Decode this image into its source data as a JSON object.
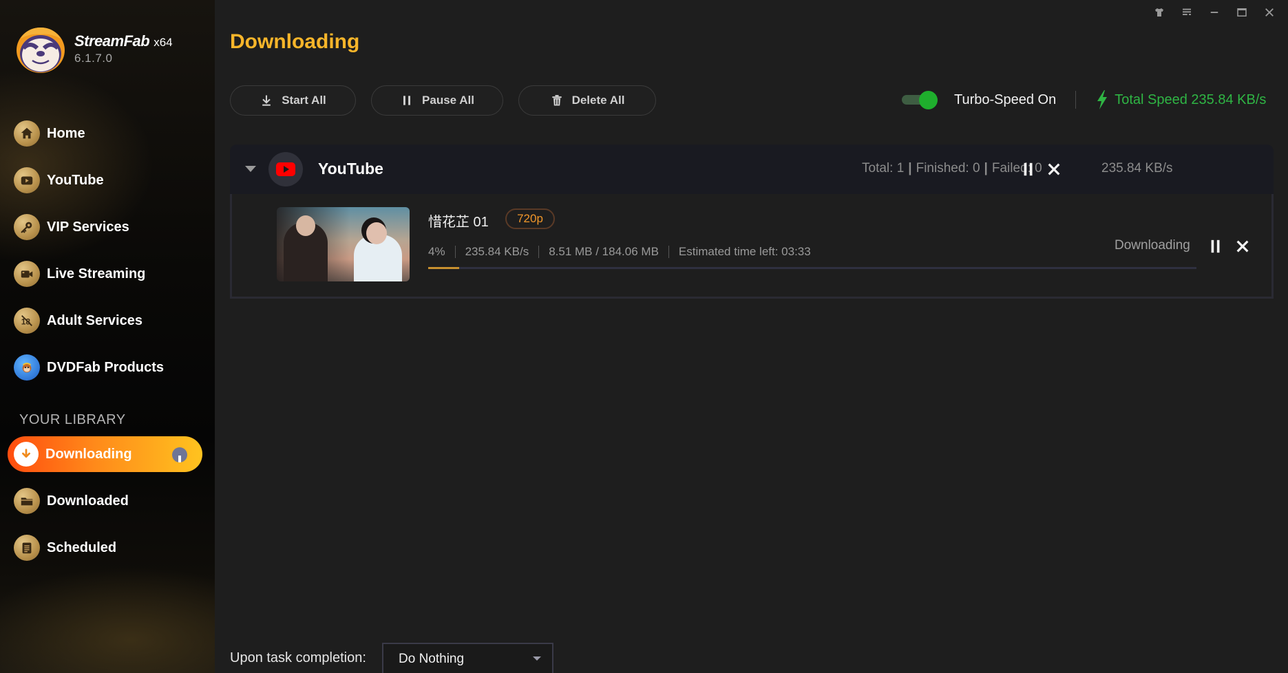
{
  "app": {
    "name": "StreamFab",
    "arch": "x64",
    "version": "6.1.7.0"
  },
  "window_controls": [
    {
      "name": "skin-icon",
      "label": "Skin"
    },
    {
      "name": "menu-icon",
      "label": "Menu"
    },
    {
      "name": "minimize-icon",
      "label": "Minimize"
    },
    {
      "name": "maximize-icon",
      "label": "Maximize"
    },
    {
      "name": "close-icon",
      "label": "Close"
    }
  ],
  "sidebar": {
    "items": [
      {
        "label": "Home",
        "icon": "home-icon"
      },
      {
        "label": "YouTube",
        "icon": "youtube-icon"
      },
      {
        "label": "VIP Services",
        "icon": "key-icon"
      },
      {
        "label": "Live Streaming",
        "icon": "video-camera-icon"
      },
      {
        "label": "Adult Services",
        "icon": "no-18-icon"
      },
      {
        "label": "DVDFab Products",
        "icon": "dvdfab-mascot-icon"
      }
    ],
    "library_title": "YOUR LIBRARY",
    "library": [
      {
        "label": "Downloading",
        "icon": "download-icon",
        "active": true
      },
      {
        "label": "Downloaded",
        "icon": "folder-icon",
        "active": false
      },
      {
        "label": "Scheduled",
        "icon": "clipboard-list-icon",
        "active": false
      }
    ]
  },
  "main": {
    "title": "Downloading",
    "toolbar": {
      "start_all": "Start All",
      "pause_all": "Pause All",
      "delete_all": "Delete All"
    },
    "turbo": {
      "enabled": true,
      "label": "Turbo-Speed On"
    },
    "total_speed": "Total Speed 235.84 KB/s",
    "colors": {
      "accent": "#f7b52a",
      "speed_green": "#2fb544",
      "active_gradient_start": "#ff4d0f",
      "active_gradient_end": "#ffc31f",
      "quality_badge": "#f0962a",
      "progress": "#c8902f"
    },
    "groups": [
      {
        "service": "YouTube",
        "stats": {
          "total": "Total: 1",
          "finished": "Finished: 0",
          "failed": "Failed: 0",
          "separator": "|"
        },
        "speed": "235.84 KB/s",
        "tasks": [
          {
            "title": "惜花芷 01",
            "quality": "720p",
            "percent_label": "4%",
            "progress": 0.04,
            "speed": "235.84 KB/s",
            "size": "8.51 MB / 184.06 MB",
            "eta": "Estimated time left: 03:33",
            "status": "Downloading"
          }
        ]
      }
    ]
  },
  "footer": {
    "completion_label": "Upon task completion:",
    "completion_value": "Do Nothing"
  }
}
